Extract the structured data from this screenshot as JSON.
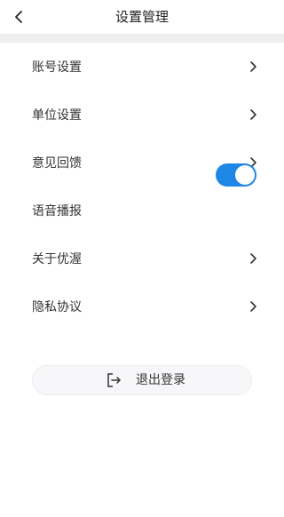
{
  "header": {
    "title": "设置管理",
    "back_icon": "chevron-left-icon"
  },
  "settings": {
    "items": [
      {
        "label": "账号设置",
        "type": "link"
      },
      {
        "label": "单位设置",
        "type": "link"
      },
      {
        "label": "意见回馈",
        "type": "link"
      },
      {
        "label": "语音播报",
        "type": "toggle",
        "on": true
      },
      {
        "label": "关于优渥",
        "type": "link"
      },
      {
        "label": "隐私协议",
        "type": "link"
      }
    ]
  },
  "logout": {
    "label": "退出登录",
    "icon": "logout-icon"
  },
  "colors": {
    "accent": "#1e87e5",
    "divider": "#efeff2",
    "text": "#333333"
  }
}
